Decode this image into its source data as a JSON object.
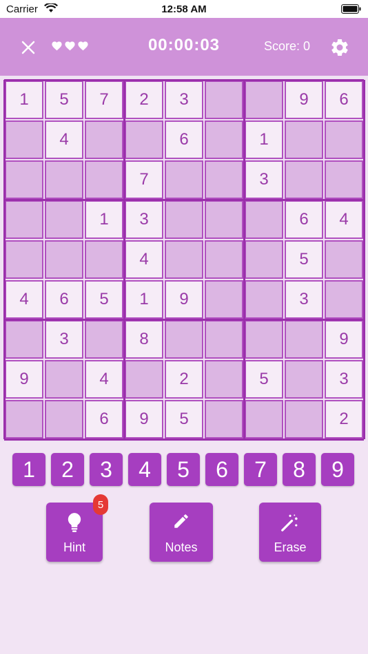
{
  "status_bar": {
    "carrier": "Carrier",
    "time": "12:58 AM"
  },
  "header": {
    "timer": "00:00:03",
    "score": "Score: 0",
    "lives": 3
  },
  "board": {
    "rows": [
      [
        "1",
        "5",
        "7",
        "2",
        "3",
        "",
        "",
        "9",
        "6"
      ],
      [
        "",
        "4",
        "",
        "",
        "6",
        "",
        "1",
        "",
        ""
      ],
      [
        "",
        "",
        "",
        "7",
        "",
        "",
        "3",
        "",
        ""
      ],
      [
        "",
        "",
        "1",
        "3",
        "",
        "",
        "",
        "6",
        "4"
      ],
      [
        "",
        "",
        "",
        "4",
        "",
        "",
        "",
        "5",
        ""
      ],
      [
        "4",
        "6",
        "5",
        "1",
        "9",
        "",
        "",
        "3",
        ""
      ],
      [
        "",
        "3",
        "",
        "8",
        "",
        "",
        "",
        "",
        "9"
      ],
      [
        "9",
        "",
        "4",
        "",
        "2",
        "",
        "5",
        "",
        "3"
      ],
      [
        "",
        "",
        "6",
        "9",
        "5",
        "",
        "",
        "",
        "2"
      ]
    ]
  },
  "number_pad": [
    "1",
    "2",
    "3",
    "4",
    "5",
    "6",
    "7",
    "8",
    "9"
  ],
  "actions": {
    "hint": {
      "label": "Hint",
      "badge": "5"
    },
    "notes": {
      "label": "Notes"
    },
    "erase": {
      "label": "Erase"
    }
  },
  "colors": {
    "header": "#cf92d9",
    "accent": "#a63ec0",
    "given_cell": "#f6ecf7",
    "blank_cell": "#dcb6e3",
    "badge": "#e53935"
  },
  "icons": {
    "close": "close-icon",
    "heart": "heart-icon",
    "settings": "gear-icon",
    "hint": "lightbulb-icon",
    "notes": "pencil-icon",
    "erase": "magic-wand-icon"
  }
}
